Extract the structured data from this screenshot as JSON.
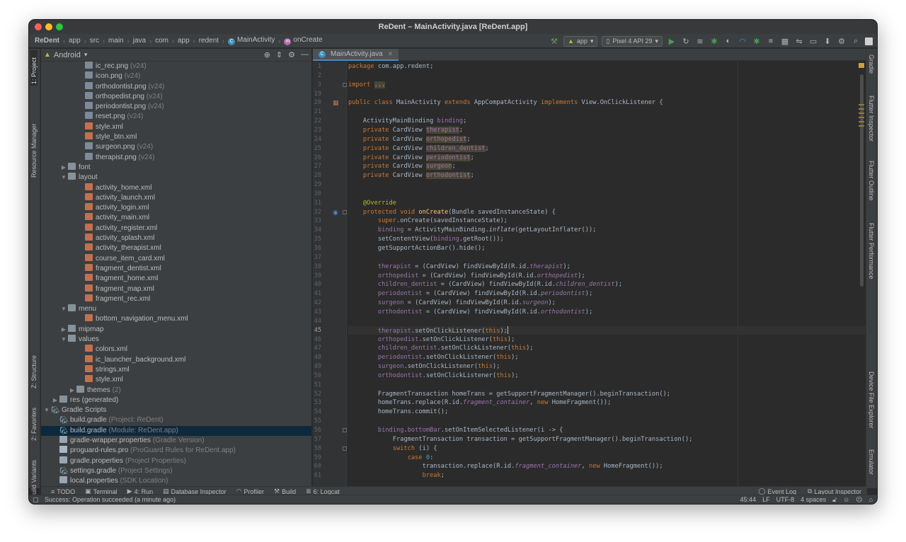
{
  "window": {
    "title": "ReDent – MainActivity.java [ReDent.app]"
  },
  "breadcrumbs": [
    {
      "label": "ReDent"
    },
    {
      "label": "app"
    },
    {
      "label": "src"
    },
    {
      "label": "main"
    },
    {
      "label": "java"
    },
    {
      "label": "com"
    },
    {
      "label": "app"
    },
    {
      "label": "redent"
    },
    {
      "label": "MainActivity"
    },
    {
      "label": "onCreate"
    }
  ],
  "toolbar": {
    "run_config": "app",
    "device": "Pixel 4 API 29"
  },
  "left_strip": {
    "project": "1: Project",
    "resource_manager": "Resource Manager",
    "structure": "Z: Structure",
    "favorites": "2: Favorites",
    "build_variants": "Build Variants"
  },
  "right_strip": {
    "gradle": "Gradle",
    "flutter_inspector": "Flutter Inspector",
    "flutter_outline": "Flutter Outline",
    "flutter_performance": "Flutter Performance",
    "device_file_explorer": "Device File Explorer",
    "emulator": "Emulator"
  },
  "project": {
    "view_mode": "Android",
    "tree": [
      {
        "label": "ic_rec.png",
        "hint": "(v24)",
        "icon": "png",
        "indent": 4
      },
      {
        "label": "icon.png",
        "hint": "(v24)",
        "icon": "png",
        "indent": 4
      },
      {
        "label": "orthodontist.png",
        "hint": "(v24)",
        "icon": "png",
        "indent": 4
      },
      {
        "label": "orthopedist.png",
        "hint": "(v24)",
        "icon": "png",
        "indent": 4
      },
      {
        "label": "periodontist.png",
        "hint": "(v24)",
        "icon": "png",
        "indent": 4
      },
      {
        "label": "reset.png",
        "hint": "(v24)",
        "icon": "png",
        "indent": 4
      },
      {
        "label": "style.xml",
        "hint": "",
        "icon": "xml",
        "indent": 4
      },
      {
        "label": "style_btn.xml",
        "hint": "",
        "icon": "xml",
        "indent": 4
      },
      {
        "label": "surgeon.png",
        "hint": "(v24)",
        "icon": "png",
        "indent": 4
      },
      {
        "label": "therapist.png",
        "hint": "(v24)",
        "icon": "png",
        "indent": 4
      },
      {
        "label": "font",
        "hint": "",
        "icon": "folder",
        "indent": 2,
        "arrow": "▶"
      },
      {
        "label": "layout",
        "hint": "",
        "icon": "folder",
        "indent": 2,
        "arrow": "▼"
      },
      {
        "label": "activity_home.xml",
        "hint": "",
        "icon": "xml",
        "indent": 4
      },
      {
        "label": "activity_launch.xml",
        "hint": "",
        "icon": "xml",
        "indent": 4
      },
      {
        "label": "activity_login.xml",
        "hint": "",
        "icon": "xml",
        "indent": 4
      },
      {
        "label": "activity_main.xml",
        "hint": "",
        "icon": "xml",
        "indent": 4
      },
      {
        "label": "activity_register.xml",
        "hint": "",
        "icon": "xml",
        "indent": 4
      },
      {
        "label": "activity_splash.xml",
        "hint": "",
        "icon": "xml",
        "indent": 4
      },
      {
        "label": "activity_therapist.xml",
        "hint": "",
        "icon": "xml",
        "indent": 4
      },
      {
        "label": "course_item_card.xml",
        "hint": "",
        "icon": "xml",
        "indent": 4
      },
      {
        "label": "fragment_dentist.xml",
        "hint": "",
        "icon": "xml",
        "indent": 4
      },
      {
        "label": "fragment_home.xml",
        "hint": "",
        "icon": "xml",
        "indent": 4
      },
      {
        "label": "fragment_map.xml",
        "hint": "",
        "icon": "xml",
        "indent": 4
      },
      {
        "label": "fragment_rec.xml",
        "hint": "",
        "icon": "xml",
        "indent": 4
      },
      {
        "label": "menu",
        "hint": "",
        "icon": "folder",
        "indent": 2,
        "arrow": "▼"
      },
      {
        "label": "bottom_navigation_menu.xml",
        "hint": "",
        "icon": "xml",
        "indent": 4
      },
      {
        "label": "mipmap",
        "hint": "",
        "icon": "folder",
        "indent": 2,
        "arrow": "▶"
      },
      {
        "label": "values",
        "hint": "",
        "icon": "folder",
        "indent": 2,
        "arrow": "▼"
      },
      {
        "label": "colors.xml",
        "hint": "",
        "icon": "xml",
        "indent": 4
      },
      {
        "label": "ic_launcher_background.xml",
        "hint": "",
        "icon": "xml",
        "indent": 4
      },
      {
        "label": "strings.xml",
        "hint": "",
        "icon": "xml",
        "indent": 4
      },
      {
        "label": "style.xml",
        "hint": "",
        "icon": "xml",
        "indent": 4
      },
      {
        "label": "themes",
        "hint": "(2)",
        "icon": "folder",
        "indent": 3,
        "arrow": "▶"
      },
      {
        "label": "res (generated)",
        "hint": "",
        "icon": "folder",
        "indent": 1,
        "arrow": "▶"
      },
      {
        "label": "Gradle Scripts",
        "hint": "",
        "icon": "gradle",
        "indent": 0,
        "arrow": "▼"
      },
      {
        "label": "build.gradle",
        "hint": "(Project: ReDent)",
        "icon": "gradle",
        "indent": 1
      },
      {
        "label": "build.gradle",
        "hint": "(Module: ReDent.app)",
        "icon": "gradle",
        "indent": 1,
        "selected": true
      },
      {
        "label": "gradle-wrapper.properties",
        "hint": "(Gradle Version)",
        "icon": "props",
        "indent": 1
      },
      {
        "label": "proguard-rules.pro",
        "hint": "(ProGuard Rules for ReDent.app)",
        "icon": "pro",
        "indent": 1
      },
      {
        "label": "gradle.properties",
        "hint": "(Project Properties)",
        "icon": "props",
        "indent": 1
      },
      {
        "label": "settings.gradle",
        "hint": "(Project Settings)",
        "icon": "gradle",
        "indent": 1
      },
      {
        "label": "local.properties",
        "hint": "(SDK Location)",
        "icon": "props",
        "indent": 1
      }
    ]
  },
  "editor": {
    "tab": "MainActivity.java",
    "current_line": 45,
    "lines": [
      {
        "n": 1,
        "html": "<span class='kw'>package </span>com.app.redent;"
      },
      {
        "n": 2,
        "html": ""
      },
      {
        "n": 3,
        "html": "<span class='kw'>import </span><span class='hl'>...</span>"
      },
      {
        "n": 19,
        "html": ""
      },
      {
        "n": 20,
        "html": "<span class='kw'>public class </span>MainActivity <span class='kw'>extends </span>AppCompatActivity <span class='kw'>implements </span>View.OnClickListener {"
      },
      {
        "n": 21,
        "html": ""
      },
      {
        "n": 22,
        "html": "    ActivityMainBinding <span class='fld'>binding</span>;"
      },
      {
        "n": 23,
        "html": "    <span class='kw'>private </span>CardView <span class='fld hl'>therapist</span>;"
      },
      {
        "n": 24,
        "html": "    <span class='kw'>private </span>CardView <span class='fld hl'>orthopedist</span>;"
      },
      {
        "n": 25,
        "html": "    <span class='kw'>private </span>CardView <span class='fld hl'>children_dentist</span>;"
      },
      {
        "n": 26,
        "html": "    <span class='kw'>private </span>CardView <span class='fld hl'>periodontist</span>;"
      },
      {
        "n": 27,
        "html": "    <span class='kw'>private </span>CardView <span class='fld hl'>surgeon</span>;"
      },
      {
        "n": 28,
        "html": "    <span class='kw'>private </span>CardView <span class='fld hl'>orthodontist</span>;"
      },
      {
        "n": 29,
        "html": ""
      },
      {
        "n": 30,
        "html": ""
      },
      {
        "n": 31,
        "html": "    <span class='ann'>@Override</span>"
      },
      {
        "n": 32,
        "html": "    <span class='kw'>protected void </span><span class='mth'>onCreate</span>(Bundle savedInstanceState) {"
      },
      {
        "n": 33,
        "html": "        <span class='kw'>super</span>.onCreate(savedInstanceState);"
      },
      {
        "n": 34,
        "html": "        <span class='fld'>binding </span>= ActivityMainBinding.<span class='itm'>inflate</span>(getLayoutInflater());"
      },
      {
        "n": 35,
        "html": "        setContentView(<span class='fld'>binding</span>.getRoot());"
      },
      {
        "n": 36,
        "html": "        getSupportActionBar().hide();"
      },
      {
        "n": 37,
        "html": ""
      },
      {
        "n": 38,
        "html": "        <span class='fld'>therapist </span>= (CardView) findViewById(R.id.<span class='ital'>therapist</span>);"
      },
      {
        "n": 39,
        "html": "        <span class='fld'>orthopedist </span>= (CardView) findViewById(R.id.<span class='ital'>orthopedist</span>);"
      },
      {
        "n": 40,
        "html": "        <span class='fld'>children_dentist </span>= (CardView) findViewById(R.id.<span class='ital'>children_dentist</span>);"
      },
      {
        "n": 41,
        "html": "        <span class='fld'>periodontist </span>= (CardView) findViewById(R.id.<span class='ital'>periodontist</span>);"
      },
      {
        "n": 42,
        "html": "        <span class='fld'>surgeon </span>= (CardView) findViewById(R.id.<span class='ital'>surgeon</span>);"
      },
      {
        "n": 43,
        "html": "        <span class='fld'>orthodontist </span>= (CardView) findViewById(R.id.<span class='ital'>orthodontist</span>);"
      },
      {
        "n": 44,
        "html": ""
      },
      {
        "n": 45,
        "html": "        <span class='fld'>therapist</span>.setOnClickListener(<span class='kw'>this</span>);<span class='caret'></span>"
      },
      {
        "n": 46,
        "html": "        <span class='fld'>orthopedist</span>.setOnClickListener(<span class='kw'>this</span>);"
      },
      {
        "n": 47,
        "html": "        <span class='fld'>children_dentist</span>.setOnClickListener(<span class='kw'>this</span>);"
      },
      {
        "n": 48,
        "html": "        <span class='fld'>periodontist</span>.setOnClickListener(<span class='kw'>this</span>);"
      },
      {
        "n": 49,
        "html": "        <span class='fld'>surgeon</span>.setOnClickListener(<span class='kw'>this</span>);"
      },
      {
        "n": 50,
        "html": "        <span class='fld'>orthodontist</span>.setOnClickListener(<span class='kw'>this</span>);"
      },
      {
        "n": 51,
        "html": ""
      },
      {
        "n": 52,
        "html": "        FragmentTransaction homeTrans = getSupportFragmentManager().beginTransaction();"
      },
      {
        "n": 53,
        "html": "        homeTrans.replace(R.id.<span class='ital'>fragment_container</span>, <span class='kw'>new </span>HomeFragment());"
      },
      {
        "n": 54,
        "html": "        homeTrans.commit();"
      },
      {
        "n": 55,
        "html": ""
      },
      {
        "n": 56,
        "html": "        <span class='fld'>binding</span>.<span class='fld'>bottomBar</span>.setOnItemSelectedListener(i -> {"
      },
      {
        "n": 57,
        "html": "            FragmentTransaction transaction = getSupportFragmentManager().beginTransaction();"
      },
      {
        "n": 58,
        "html": "            <span class='kw'>switch </span>(i) {"
      },
      {
        "n": 59,
        "html": "                <span class='kw'>case </span><span class='num'>0</span>:"
      },
      {
        "n": 60,
        "html": "                    transaction.replace(R.id.<span class='ital'>fragment_container</span>, <span class='kw'>new </span>HomeFragment());"
      },
      {
        "n": 61,
        "html": "                    <span class='kw'>break</span>;"
      }
    ]
  },
  "tool_windows": {
    "left": [
      {
        "label": "TODO",
        "icon": "≡"
      },
      {
        "label": "Terminal",
        "icon": "▣"
      },
      {
        "label": "4: Run",
        "icon": "▶"
      },
      {
        "label": "Database Inspector",
        "icon": "▤"
      },
      {
        "label": "Profiler",
        "icon": "◠"
      },
      {
        "label": "Build",
        "icon": "⚒"
      },
      {
        "label": "6: Logcat",
        "icon": "≣"
      }
    ],
    "right": [
      {
        "label": "Event Log",
        "icon": "◯"
      },
      {
        "label": "Layout Inspector",
        "icon": "⧉"
      }
    ]
  },
  "status": {
    "message": "Success: Operation succeeded (a minute ago)",
    "caret": "45:44",
    "line_sep": "LF",
    "encoding": "UTF-8",
    "indent": "4 spaces"
  }
}
